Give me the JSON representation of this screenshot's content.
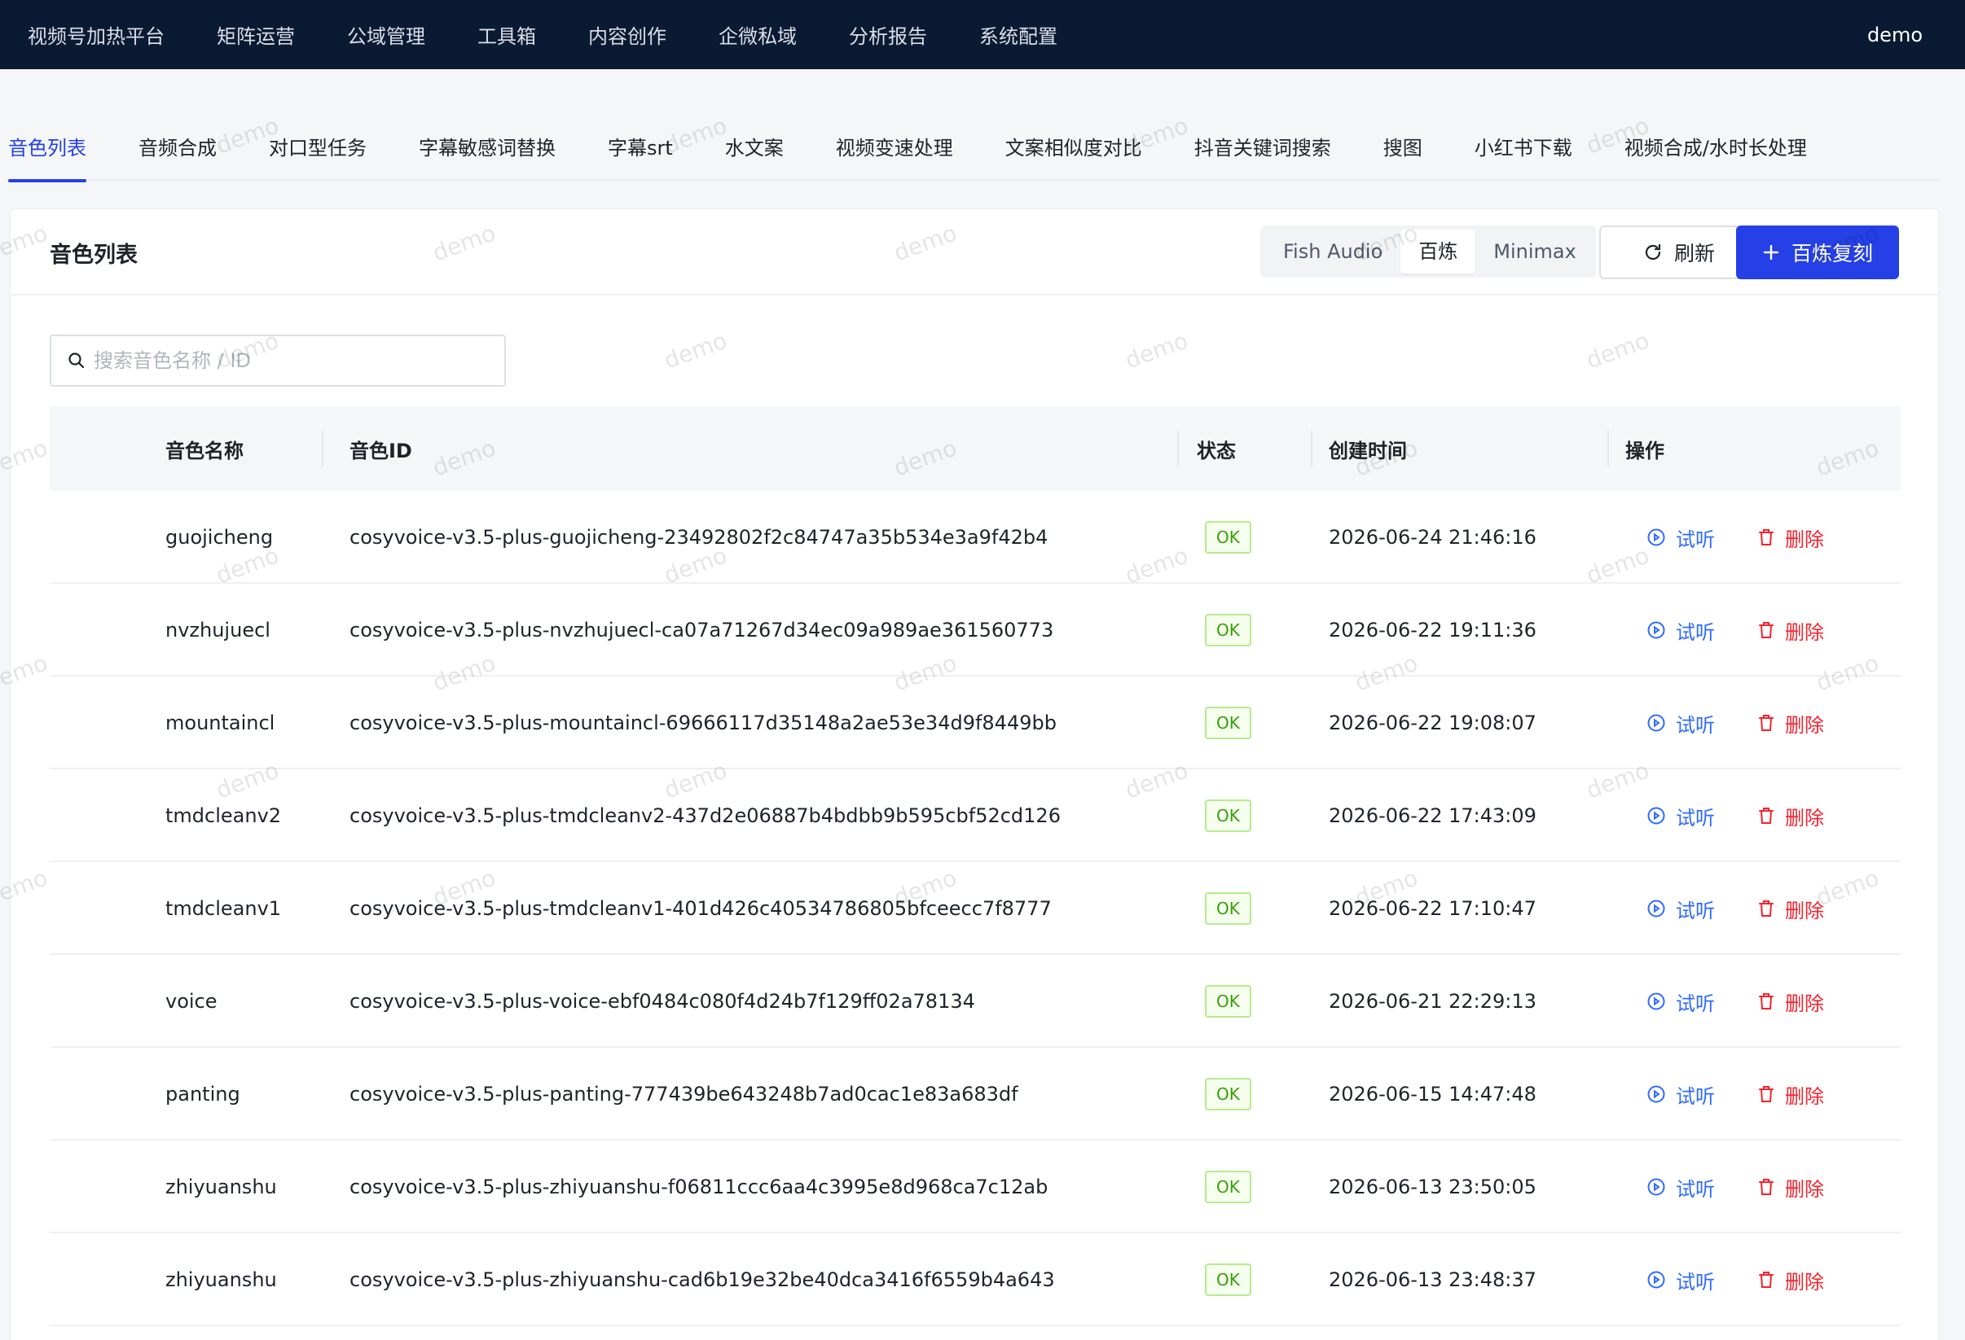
{
  "topnav": {
    "items": [
      "视频号加热平台",
      "矩阵运营",
      "公域管理",
      "工具箱",
      "内容创作",
      "企微私域",
      "分析报告",
      "系统配置"
    ],
    "user": "demo"
  },
  "tabs": [
    "音色列表",
    "音频合成",
    "对口型任务",
    "字幕敏感词替换",
    "字幕srt",
    "水文案",
    "视频变速处理",
    "文案相似度对比",
    "抖音关键词搜索",
    "搜图",
    "小红书下载",
    "视频合成/水时长处理"
  ],
  "active_tab": "音色列表",
  "card": {
    "title": "音色列表",
    "providers": [
      "Fish Audio",
      "百炼",
      "Minimax"
    ],
    "active_provider": "百炼",
    "refresh_label": "刷新",
    "primary_label": "百炼复刻"
  },
  "search": {
    "placeholder": "搜索音色名称 / ID",
    "value": ""
  },
  "table": {
    "columns": [
      "音色名称",
      "音色ID",
      "状态",
      "创建时间",
      "操作"
    ],
    "rows": [
      {
        "name": "guojicheng",
        "id": "cosyvoice-v3.5-plus-guojicheng-23492802f2c84747a35b534e3a9f42b4",
        "status": "OK",
        "created": "2026-06-24 21:46:16"
      },
      {
        "name": "nvzhujuecl",
        "id": "cosyvoice-v3.5-plus-nvzhujuecl-ca07a71267d34ec09a989ae361560773",
        "status": "OK",
        "created": "2026-06-22 19:11:36"
      },
      {
        "name": "mountaincl",
        "id": "cosyvoice-v3.5-plus-mountaincl-69666117d35148a2ae53e34d9f8449bb",
        "status": "OK",
        "created": "2026-06-22 19:08:07"
      },
      {
        "name": "tmdcleanv2",
        "id": "cosyvoice-v3.5-plus-tmdcleanv2-437d2e06887b4bdbb9b595cbf52cd126",
        "status": "OK",
        "created": "2026-06-22 17:43:09"
      },
      {
        "name": "tmdcleanv1",
        "id": "cosyvoice-v3.5-plus-tmdcleanv1-401d426c40534786805bfceecc7f8777",
        "status": "OK",
        "created": "2026-06-22 17:10:47"
      },
      {
        "name": "voice",
        "id": "cosyvoice-v3.5-plus-voice-ebf0484c080f4d24b7f129ff02a78134",
        "status": "OK",
        "created": "2026-06-21 22:29:13"
      },
      {
        "name": "panting",
        "id": "cosyvoice-v3.5-plus-panting-777439be643248b7ad0cac1e83a683df",
        "status": "OK",
        "created": "2026-06-15 14:47:48"
      },
      {
        "name": "zhiyuanshu",
        "id": "cosyvoice-v3.5-plus-zhiyuanshu-f06811ccc6aa4c3995e8d968ca7c12ab",
        "status": "OK",
        "created": "2026-06-13 23:50:05"
      },
      {
        "name": "zhiyuanshu",
        "id": "cosyvoice-v3.5-plus-zhiyuanshu-cad6b19e32be40dca3416f6559b4a643",
        "status": "OK",
        "created": "2026-06-13 23:48:37"
      }
    ],
    "action_listen": "试听",
    "action_delete": "删除"
  },
  "watermark": "demo",
  "colors": {
    "topbar": "#0b1a33",
    "accent": "#2440e6",
    "listen": "#2f6bff",
    "delete": "#f5222d",
    "ok_badge": "#389e0d"
  }
}
